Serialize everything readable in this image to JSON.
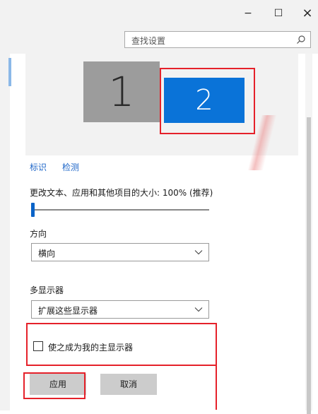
{
  "window": {
    "minimize": "−",
    "maximize": "☐",
    "close": "×"
  },
  "search": {
    "placeholder": "查找设置"
  },
  "displays": {
    "monitor1": "1",
    "monitor2": "2"
  },
  "links": {
    "identify": "标识",
    "detect": "检测"
  },
  "scale": {
    "label": "更改文本、应用和其他项目的大小: 100% (推荐)",
    "value": 0.0
  },
  "orientation": {
    "label": "方向",
    "value": "横向"
  },
  "multi_display": {
    "label": "多显示器",
    "value": "扩展这些显示器"
  },
  "main_display": {
    "label": "使之成为我的主显示器",
    "checked": false
  },
  "buttons": {
    "apply": "应用",
    "cancel": "取消"
  },
  "colors": {
    "accent": "#0a73d8",
    "highlight": "#e5212a",
    "link": "#2168c9"
  }
}
